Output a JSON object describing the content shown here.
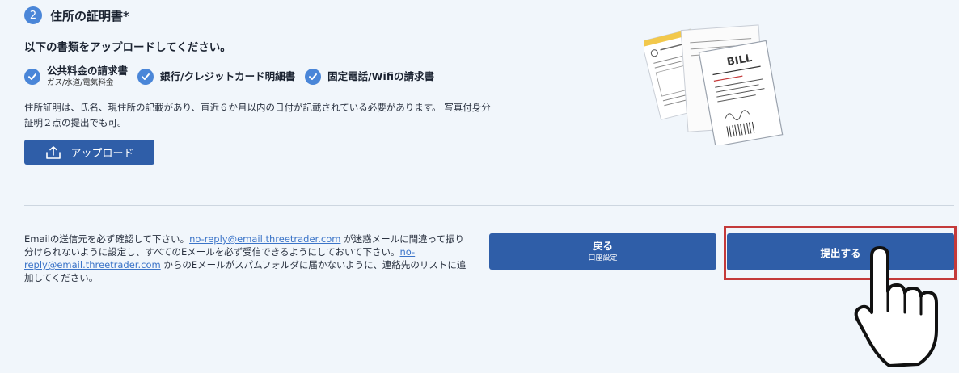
{
  "section": {
    "step_number": "2",
    "title": "住所の証明書*",
    "instruction": "以下の書類をアップロードしてください。"
  },
  "documents": [
    {
      "label": "公共料金の請求書",
      "sub": "ガス/水道/電気料金"
    },
    {
      "label": "銀行/クレジットカード明細書"
    },
    {
      "label": "固定電話/Wifiの請求書"
    }
  ],
  "note": "住所証明は、氏名、現住所の記載があり、直近６か月以内の日付が記載されている必要があります。 写真付身分証明２点の提出でも可。",
  "upload_button": {
    "label": "アップロード",
    "icon": "upload-icon"
  },
  "illustration": {
    "bill_text": "BILL"
  },
  "email_note": {
    "part1": "Emailの送信元を必ず確認して下さい。",
    "link1": "no-reply@email.threetrader.com",
    "part2": " が迷惑メールに間違って振り分けられないように設定し、すべてのEメールを必ず受信できるようにしておいて下さい。",
    "link2": "no-reply@email.threetrader.com",
    "part3": " からのEメールがスパムフォルダに届かないように、連絡先のリストに追加してください。"
  },
  "buttons": {
    "back_label": "戻る",
    "back_sub": "口座設定",
    "submit_label": "提出する"
  },
  "colors": {
    "primary": "#2f5ea8",
    "check": "#4a86d8",
    "highlight": "#c43a3a",
    "background": "#f1f6fb"
  }
}
